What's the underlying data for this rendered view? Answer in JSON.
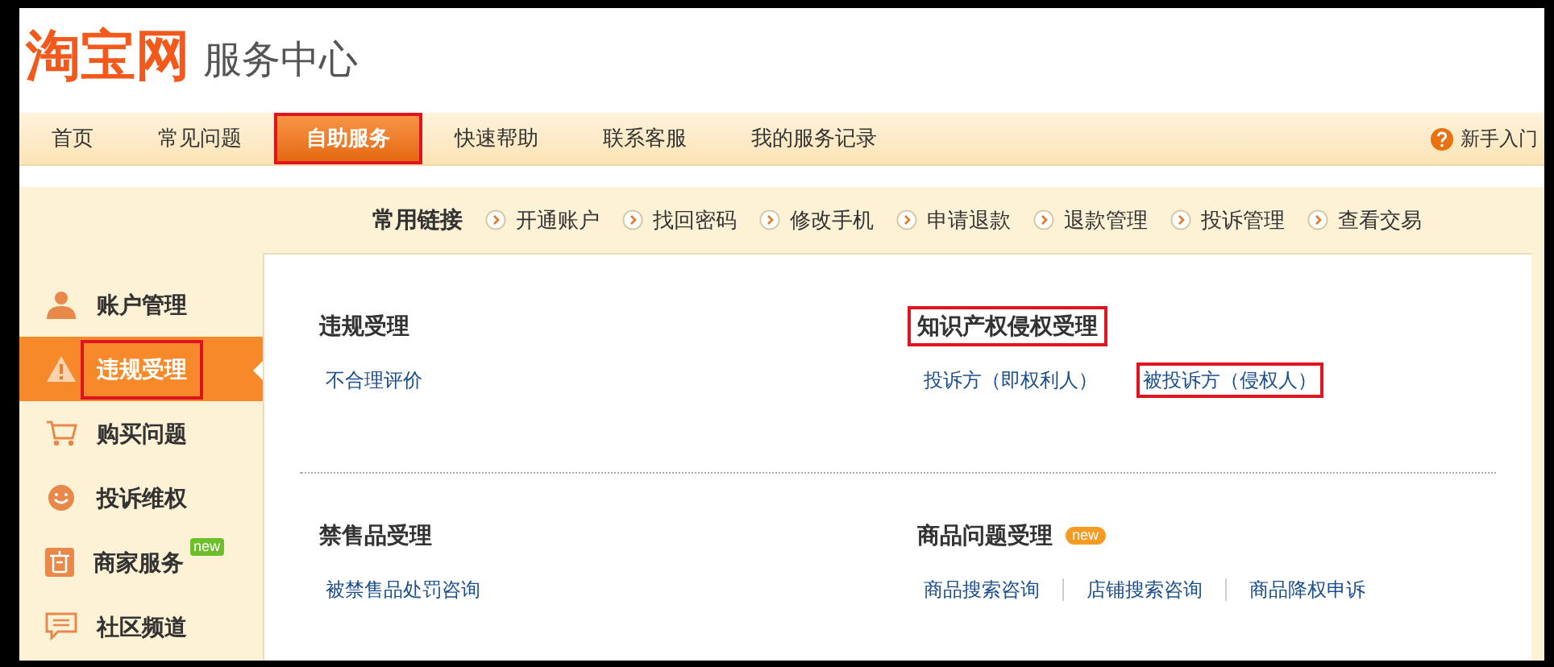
{
  "logo": {
    "brand": "淘宝网",
    "subtitle": "服务中心"
  },
  "nav": {
    "tabs": [
      {
        "label": "首页",
        "selected": false,
        "highlighted": false
      },
      {
        "label": "常见问题",
        "selected": false,
        "highlighted": false
      },
      {
        "label": "自助服务",
        "selected": true,
        "highlighted": true
      },
      {
        "label": "快速帮助",
        "selected": false,
        "highlighted": false
      },
      {
        "label": "联系客服",
        "selected": false,
        "highlighted": false
      },
      {
        "label": "我的服务记录",
        "selected": false,
        "highlighted": false
      }
    ],
    "help_link": "新手入门"
  },
  "quick_links": {
    "title": "常用链接",
    "links": [
      "开通账户",
      "找回密码",
      "修改手机",
      "申请退款",
      "退款管理",
      "投诉管理",
      "查看交易"
    ]
  },
  "sidebar": {
    "items": [
      {
        "label": "账户管理",
        "kind": "person",
        "selected": false,
        "highlighted": false
      },
      {
        "label": "违规受理",
        "kind": "warning",
        "selected": true,
        "highlighted": true
      },
      {
        "label": "购买问题",
        "kind": "cart",
        "selected": false,
        "highlighted": false
      },
      {
        "label": "投诉维权",
        "kind": "smile",
        "selected": false,
        "highlighted": false
      },
      {
        "label": "商家服务",
        "kind": "shop",
        "selected": false,
        "highlighted": false,
        "badge": "new"
      },
      {
        "label": "社区频道",
        "kind": "comment",
        "selected": false,
        "highlighted": false
      }
    ]
  },
  "sections": [
    {
      "title": "违规受理",
      "highlighted": false,
      "links": [
        {
          "label": "不合理评价",
          "highlighted": false
        }
      ]
    },
    {
      "title": "知识产权侵权受理",
      "highlighted": true,
      "links": [
        {
          "label": "投诉方（即权利人）",
          "highlighted": false
        },
        {
          "label": "被投诉方（侵权人）",
          "highlighted": true
        }
      ]
    },
    {
      "title": "禁售品受理",
      "highlighted": false,
      "links": [
        {
          "label": "被禁售品处罚咨询",
          "highlighted": false
        }
      ]
    },
    {
      "title": "商品问题受理",
      "badge": "new",
      "highlighted": false,
      "links": [
        {
          "label": "商品搜索咨询",
          "highlighted": false
        },
        {
          "label": "店铺搜索咨询",
          "highlighted": false
        },
        {
          "label": "商品降权申诉",
          "highlighted": false
        }
      ]
    }
  ]
}
